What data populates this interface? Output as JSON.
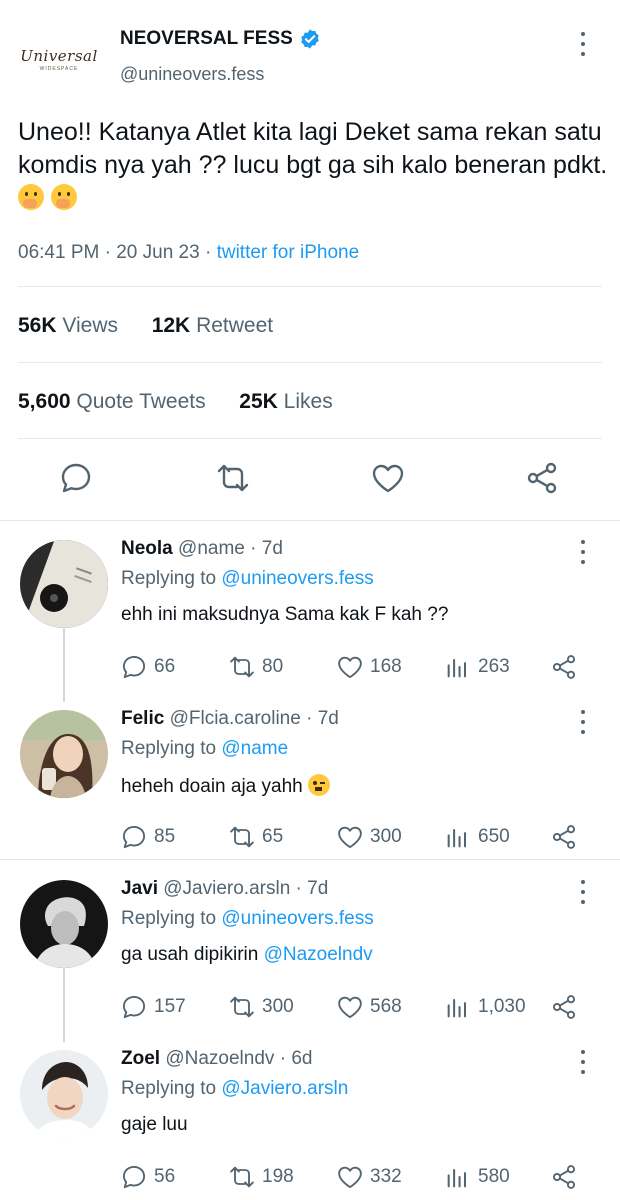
{
  "tweet": {
    "account_name": "NEOVERSAL FESS",
    "handle": "@unineovers.fess",
    "logo_text": "Universal",
    "logo_subtext": "WIDESPACE",
    "text": "Uneo!! Katanya Atlet kita lagi Deket sama rekan satu komdis nya yah ?? lucu bgt ga sih kalo beneran pdkt.",
    "emojis": [
      "hand-over-mouth-emoji",
      "hand-over-mouth-emoji"
    ],
    "time": "06:41 PM",
    "date": "20 Jun 23",
    "separator": "·",
    "source": "twitter for iPhone",
    "views_count": "56K",
    "views_label": "Views",
    "retweets_count": "12K",
    "retweets_label": "Retweet",
    "quotes_count": "5,600",
    "quotes_label": "Quote Tweets",
    "likes_count": "25K",
    "likes_label": "Likes",
    "action_icons": [
      "reply-icon",
      "retweet-icon",
      "like-icon",
      "share-icon"
    ]
  },
  "replies": [
    {
      "name": "Neola",
      "handle": "@name",
      "age": "7d",
      "replying_prefix": "Replying to",
      "replying_to": "@unineovers.fess",
      "text": "ehh ini maksudnya Sama kak F kah ??",
      "reply_count": "66",
      "retweet_count": "80",
      "like_count": "168",
      "view_count": "263"
    },
    {
      "name": "Felic",
      "handle": "@Flcia.caroline",
      "age": "7d",
      "replying_prefix": "Replying to",
      "replying_to": "@name",
      "text": "heheh doain aja yahh",
      "emoji": "winking-face-emoji",
      "reply_count": "85",
      "retweet_count": "65",
      "like_count": "300",
      "view_count": "650"
    },
    {
      "name": "Javi",
      "handle": "@Javiero.arsln",
      "age": "7d",
      "replying_prefix": "Replying to",
      "replying_to": "@unineovers.fess",
      "text": "ga usah dipikirin",
      "mention": "@Nazoelndv",
      "reply_count": "157",
      "retweet_count": "300",
      "like_count": "568",
      "view_count": "1,030"
    },
    {
      "name": "Zoel",
      "handle": "@Nazoelndv",
      "age": "6d",
      "replying_prefix": "Replying to",
      "replying_to": "@Javiero.arsln",
      "text": "gaje luu",
      "reply_count": "56",
      "retweet_count": "198",
      "like_count": "332",
      "view_count": "580"
    }
  ],
  "colors": {
    "text": "#0f1419",
    "muted": "#536471",
    "link": "#1d9bf0",
    "divider": "#e4e9ec",
    "thread_line": "#cfd9de"
  }
}
